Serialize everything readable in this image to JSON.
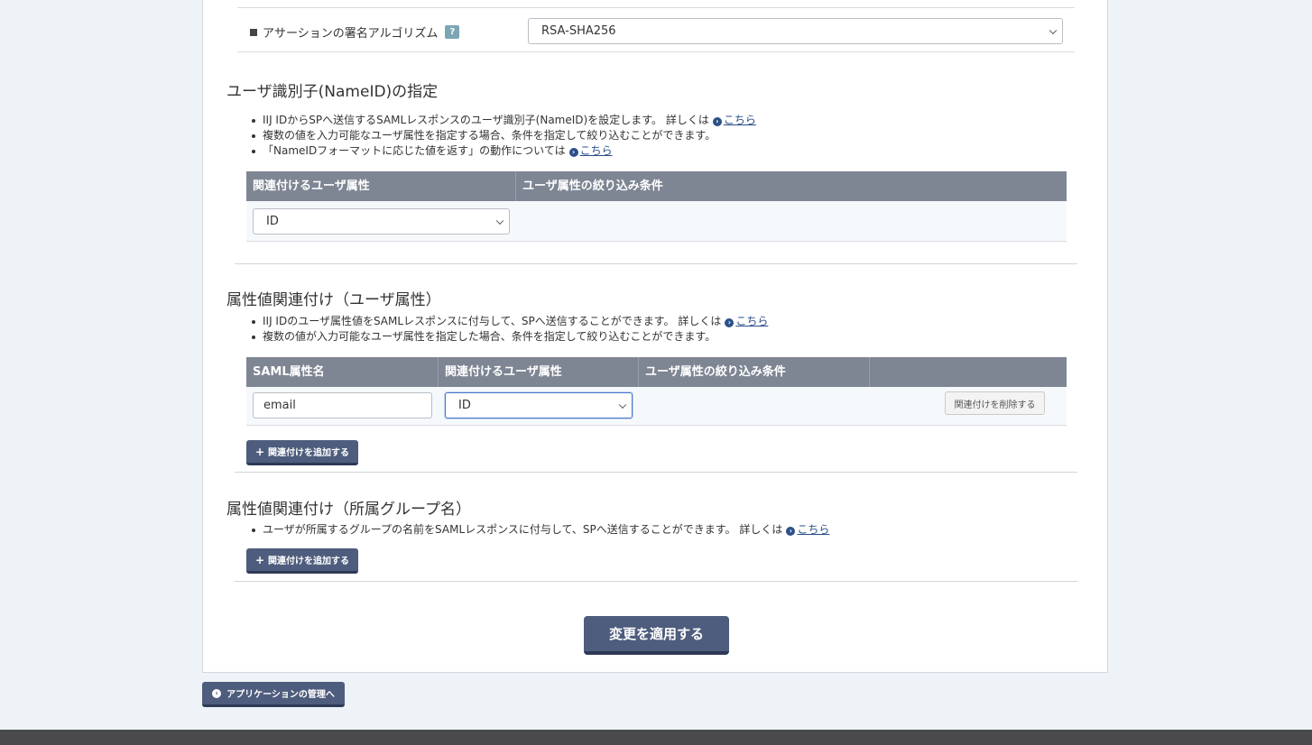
{
  "signature": {
    "label": "アサーションの署名アルゴリズム",
    "help": "?",
    "value": "RSA-SHA256"
  },
  "nameid": {
    "title": "ユーザ識別子(NameID)の指定",
    "bullets": [
      "IIJ IDからSPへ送信するSAMLレスポンスのユーザ識別子(NameID)を設定します。 詳しくは",
      "複数の値を入力可能なユーザ属性を指定する場合、条件を指定して絞り込むことができます。",
      "「NameIDフォーマットに応じた値を返す」の動作については"
    ],
    "link_text": "こちら",
    "columns": [
      "関連付けるユーザ属性",
      "ユーザ属性の絞り込み条件"
    ],
    "attr_value": "ID"
  },
  "user_attr": {
    "title": "属性値関連付け（ユーザ属性）",
    "bullets": [
      "IIJ IDのユーザ属性値をSAMLレスポンスに付与して、SPへ送信することができます。 詳しくは",
      "複数の値が入力可能なユーザ属性を指定した場合、条件を指定して絞り込むことができます。"
    ],
    "link_text": "こちら",
    "columns": [
      "SAML属性名",
      "関連付けるユーザ属性",
      "ユーザ属性の絞り込み条件",
      ""
    ],
    "row": {
      "saml_name": "email",
      "attr_value": "ID",
      "delete_label": "関連付けを削除する"
    },
    "add_label": "関連付けを追加する"
  },
  "group_attr": {
    "title": "属性値関連付け（所属グループ名）",
    "bullets": [
      "ユーザが所属するグループの名前をSAMLレスポンスに付与して、SPへ送信することができます。 詳しくは"
    ],
    "link_text": "こちら",
    "add_label": "関連付けを追加する"
  },
  "apply_label": "変更を適用する",
  "back_label": "アプリケーションの管理へ"
}
